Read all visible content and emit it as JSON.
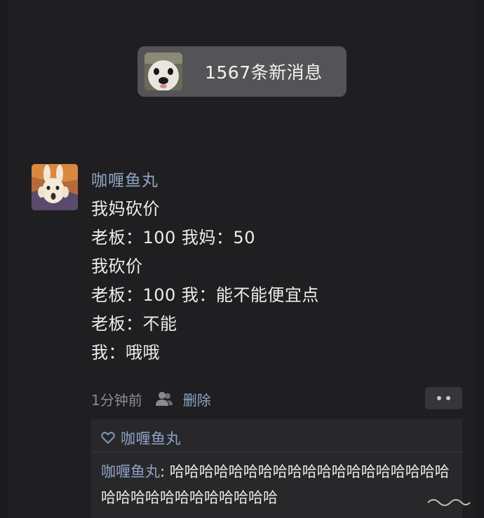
{
  "new_messages": {
    "label": "1567条新消息",
    "avatar_icon": "dog-face-avatar"
  },
  "post": {
    "author": "咖喱鱼丸",
    "avatar_icon": "screaming-rabbit-avatar",
    "lines": [
      "我妈砍价",
      "老板：100  我妈：50",
      "我砍价",
      "老板：100  我：能不能便宜点",
      "老板：不能",
      "我：哦哦"
    ],
    "time": "1分钟前",
    "delete_label": "删除"
  },
  "comments": {
    "like_icon": "heart-outline-icon",
    "liked_by": "咖喱鱼丸",
    "items": [
      {
        "author": "咖喱鱼丸",
        "separator": ": ",
        "text": "哈哈哈哈哈哈哈哈哈哈哈哈哈哈哈哈哈哈哈哈哈哈哈哈哈哈哈哈哈哈哈"
      }
    ]
  },
  "colors": {
    "background": "#1f1f22",
    "link": "#8fa5c5",
    "text": "#ededed",
    "pill": "#545457"
  }
}
